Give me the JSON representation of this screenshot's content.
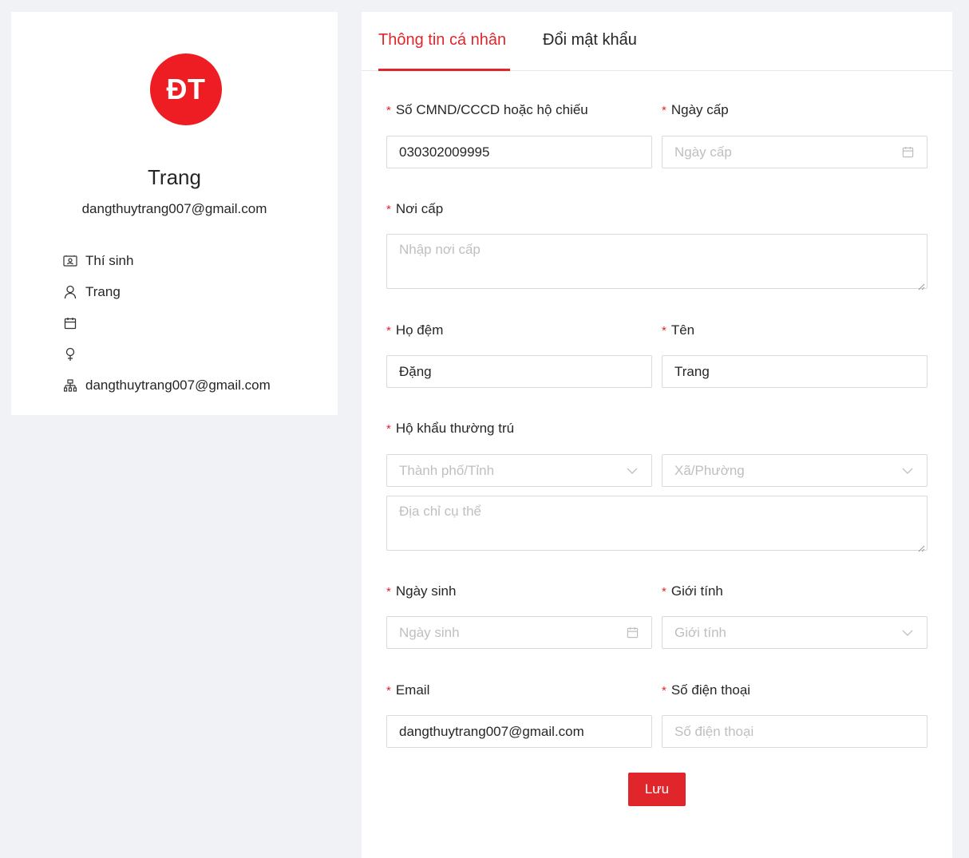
{
  "profile": {
    "avatar_initials": "ĐT",
    "avatar_color": "#ee1d24",
    "name": "Trang",
    "email": "dangthuytrang007@gmail.com",
    "info": [
      {
        "icon": "id-card-icon",
        "text": "Thí sinh"
      },
      {
        "icon": "user-icon",
        "text": "Trang"
      },
      {
        "icon": "calendar-icon",
        "text": ""
      },
      {
        "icon": "female-icon",
        "text": ""
      },
      {
        "icon": "org-icon",
        "text": "dangthuytrang007@gmail.com"
      }
    ]
  },
  "tabs": [
    {
      "label": "Thông tin cá nhân",
      "active": true
    },
    {
      "label": "Đổi mật khẩu",
      "active": false
    }
  ],
  "accent_color": "#e0262b",
  "form": {
    "id_number": {
      "label": "Số CMND/CCCD hoặc hộ chiếu",
      "value": "030302009995"
    },
    "issue_date": {
      "label": "Ngày cấp",
      "placeholder": "Ngày cấp"
    },
    "issue_place": {
      "label": "Nơi cấp",
      "placeholder": "Nhập nơi cấp"
    },
    "middle_name": {
      "label": "Họ đệm",
      "value": "Đặng"
    },
    "first_name": {
      "label": "Tên",
      "value": "Trang"
    },
    "residence": {
      "label": "Hộ khẩu thường trú",
      "city_placeholder": "Thành phố/Tỉnh",
      "ward_placeholder": "Xã/Phường",
      "address_placeholder": "Địa chỉ cụ thể"
    },
    "birth_date": {
      "label": "Ngày sinh",
      "placeholder": "Ngày sinh"
    },
    "gender": {
      "label": "Giới tính",
      "placeholder": "Giới tính"
    },
    "email": {
      "label": "Email",
      "value": "dangthuytrang007@gmail.com"
    },
    "phone": {
      "label": "Số điện thoại",
      "placeholder": "Số điện thoại"
    },
    "required_mark": "*",
    "save_label": "Lưu"
  }
}
